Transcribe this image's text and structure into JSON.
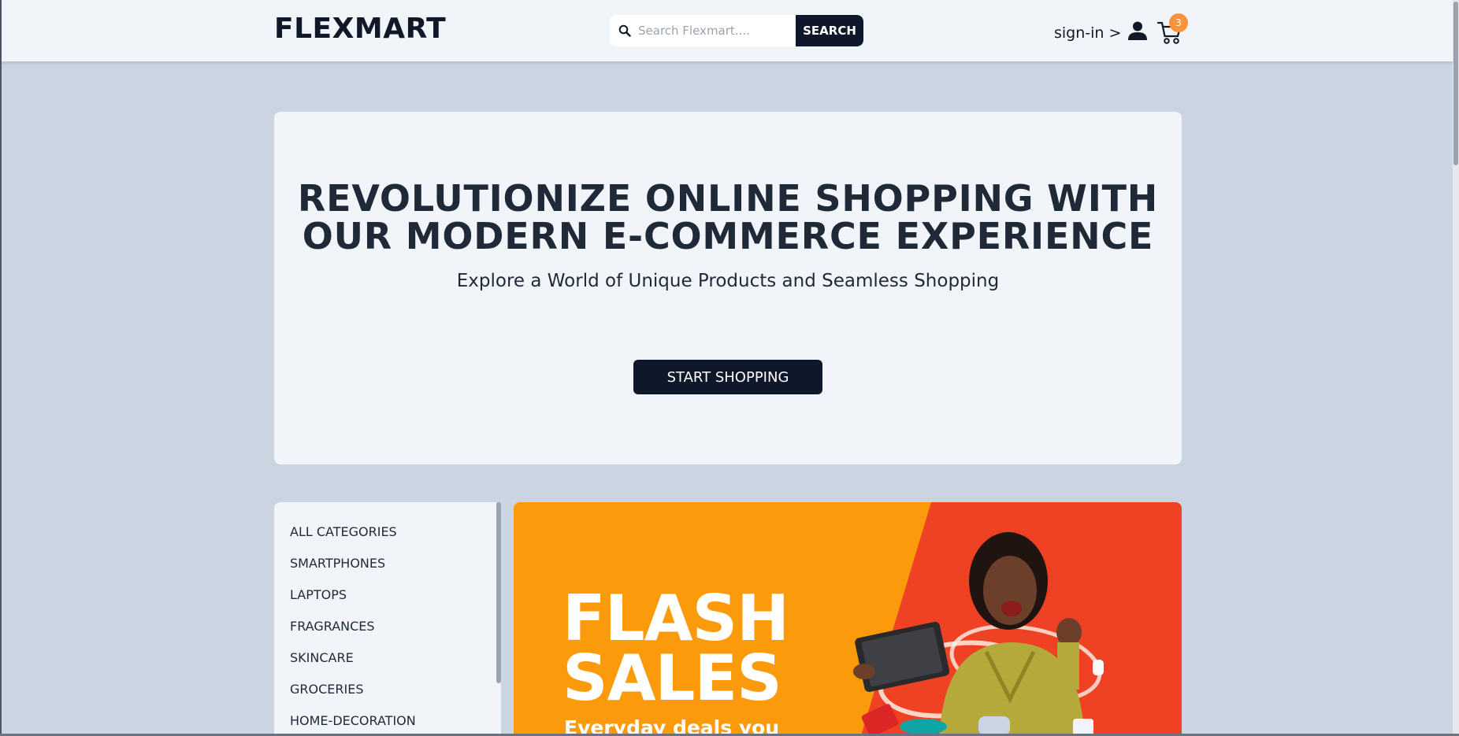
{
  "header": {
    "logo": "FLEXMART",
    "search": {
      "placeholder": "Search Flexmart....",
      "value": "",
      "button_label": "SEARCH"
    },
    "signin_label": "sign-in >",
    "cart_count": "3"
  },
  "hero": {
    "title_line1": "REVOLUTIONIZE ONLINE SHOPPING WITH",
    "title_line2": "OUR MODERN E-COMMERCE EXPERIENCE",
    "subtitle": "Explore a World of Unique Products and Seamless Shopping",
    "button_label": "START SHOPPING"
  },
  "categories": {
    "items": [
      "ALL CATEGORIES",
      "SMARTPHONES",
      "LAPTOPS",
      "FRAGRANCES",
      "SKINCARE",
      "GROCERIES",
      "HOME-DECORATION"
    ]
  },
  "banner": {
    "title_line1": "FLASH",
    "title_line2": "SALES",
    "tagline": "Everyday deals you"
  },
  "colors": {
    "page_bg": "#cbd5e1",
    "panel_bg": "#f1f5f9",
    "dark_button": "#0f172a",
    "badge": "#fb923c",
    "banner_orange": "#fb9a0a",
    "banner_red": "#ef4123"
  }
}
